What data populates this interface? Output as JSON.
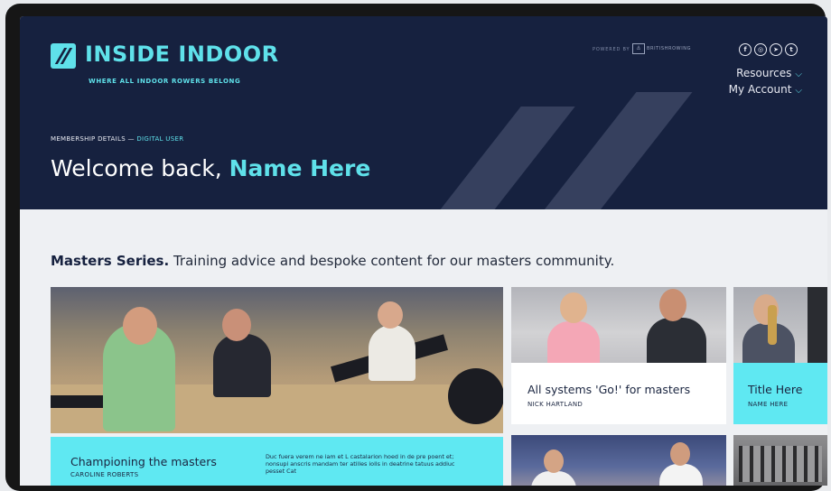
{
  "brand": {
    "name": "INSIDE INDOOR",
    "tagline": "WHERE ALL INDOOR ROWERS BELONG",
    "powered_by": "POWERED BY",
    "partner": "BRITISHROWING",
    "logo_icon": "double-slash-icon"
  },
  "social": [
    {
      "name": "facebook-icon",
      "glyph": "f"
    },
    {
      "name": "instagram-icon",
      "glyph": "◎"
    },
    {
      "name": "telegram-icon",
      "glyph": "➤"
    },
    {
      "name": "twitter-icon",
      "glyph": "t"
    }
  ],
  "nav": {
    "resources": "Resources",
    "account": "My Account",
    "chevron": "⌵"
  },
  "membership": {
    "label": "MEMBERSHIP DETAILS",
    "separator": " — ",
    "type": "DIGITAL USER"
  },
  "welcome": {
    "greeting": "Welcome back, ",
    "name": "Name Here"
  },
  "section": {
    "title_bold": "Masters Series.",
    "title_rest": " Training advice and bespoke content for our masters community."
  },
  "cards": [
    {
      "title": "Championing the masters",
      "author": "CAROLINE ROBERTS",
      "excerpt": "Duc fuera verem ne iam et L castalarion hoed in de pre poent et; nonsupi anscris mandam ter atilles iolls in deatrine tatuus addiuc pesset Cat"
    },
    {
      "title": "All systems 'Go!' for masters",
      "author": "NICK HARTLAND"
    },
    {
      "title": "Title Here",
      "author": "NAME HERE"
    }
  ],
  "colors": {
    "header_bg": "#16213f",
    "accent": "#5fe1ea",
    "card_cyan": "#5fe8f2",
    "page_bg": "#eef0f3"
  }
}
